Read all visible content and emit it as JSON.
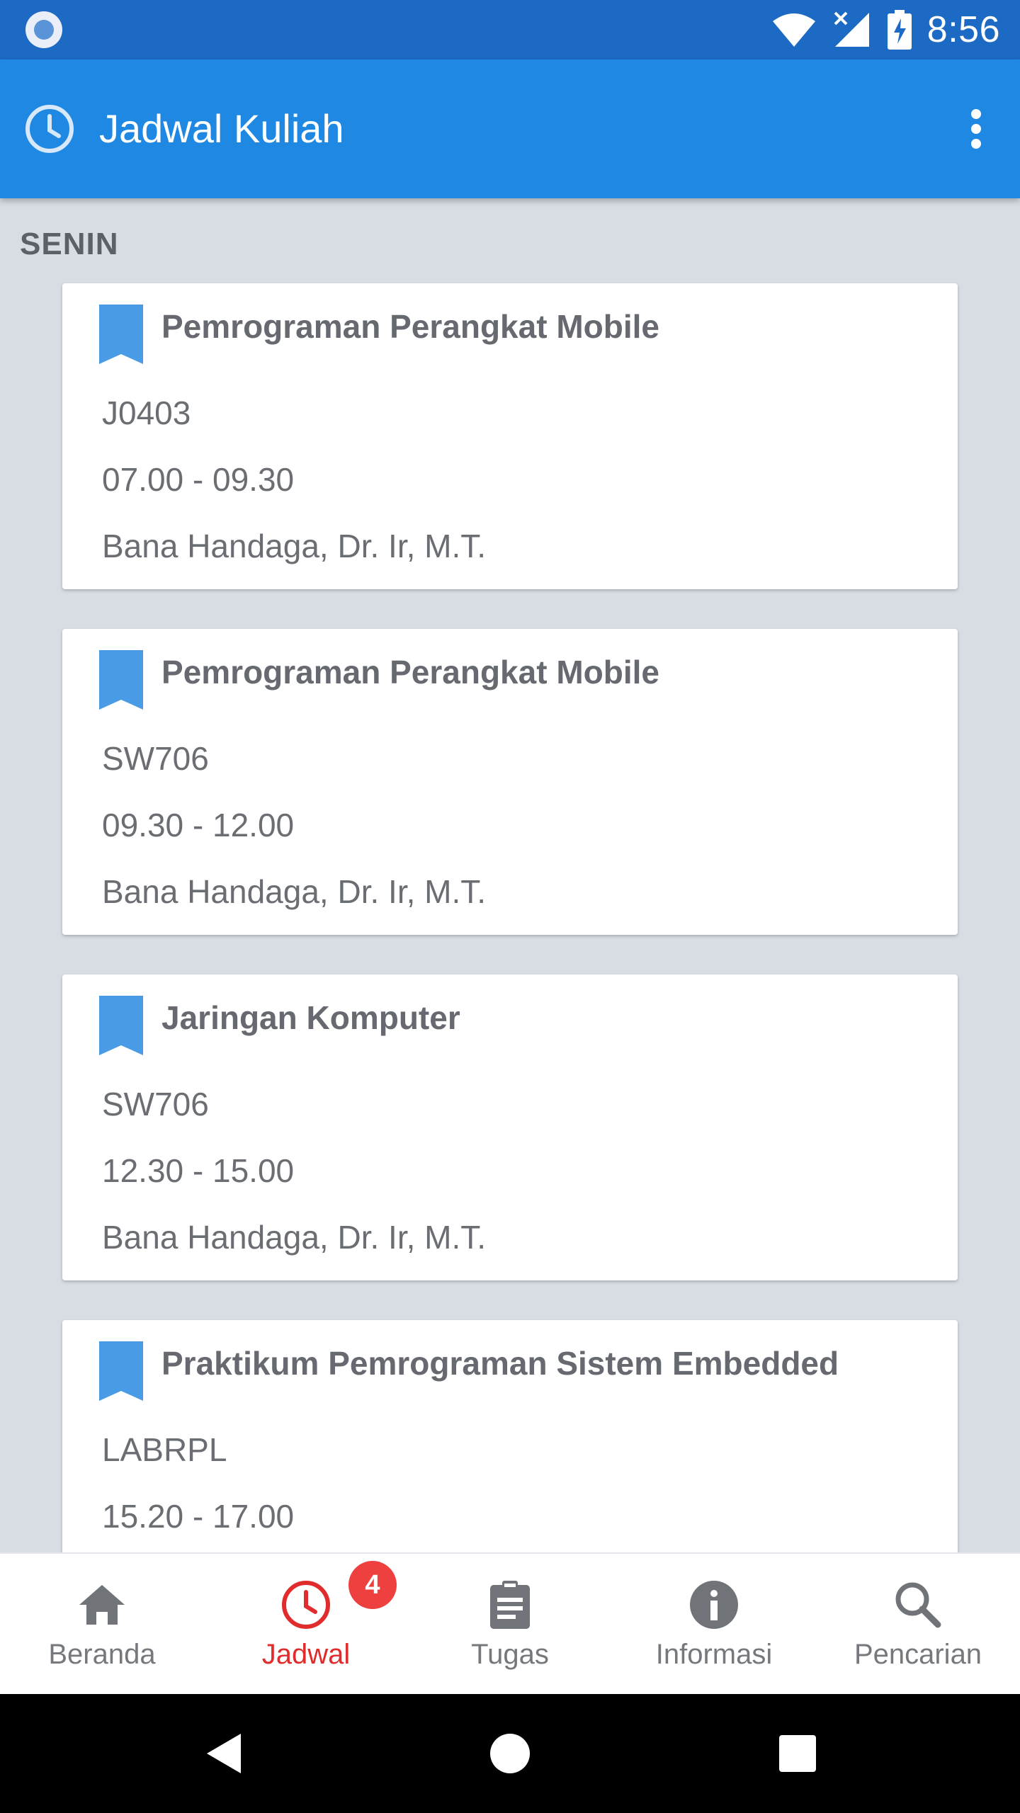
{
  "status_bar": {
    "time": "8:56",
    "icons": [
      "app-notification-icon",
      "wifi-icon",
      "cellular-signal-icon",
      "battery-charging-icon"
    ]
  },
  "app_bar": {
    "icon": "clock-icon",
    "title": "Jadwal Kuliah",
    "menu_icon": "overflow-menu-icon"
  },
  "schedule": {
    "day": "SENIN",
    "courses": [
      {
        "title": "Pemrograman Perangkat Mobile",
        "room": "J0403",
        "time": "07.00 - 09.30",
        "lecturer": "Bana Handaga, Dr. Ir, M.T."
      },
      {
        "title": "Pemrograman Perangkat Mobile",
        "room": "SW706",
        "time": "09.30 - 12.00",
        "lecturer": "Bana Handaga, Dr. Ir, M.T."
      },
      {
        "title": "Jaringan Komputer",
        "room": "SW706",
        "time": "12.30 - 15.00",
        "lecturer": "Bana Handaga, Dr. Ir, M.T."
      },
      {
        "title": "Praktikum Pemrograman Sistem Embedded",
        "room": "LABRPL",
        "time": "15.20 - 17.00",
        "lecturer": ""
      }
    ]
  },
  "bottom_nav": {
    "items": [
      {
        "label": "Beranda",
        "icon": "home-icon"
      },
      {
        "label": "Jadwal",
        "icon": "clock-icon",
        "badge": "4",
        "active": true
      },
      {
        "label": "Tugas",
        "icon": "clipboard-icon"
      },
      {
        "label": "Informasi",
        "icon": "info-icon"
      },
      {
        "label": "Pencarian",
        "icon": "search-icon"
      }
    ]
  },
  "colors": {
    "status_bar": "#1c6ac4",
    "app_bar": "#1f88e3",
    "accent_blue": "#4a9be6",
    "active_red": "#e02c2c",
    "badge_red": "#ef4040",
    "background": "#d8dde4"
  }
}
